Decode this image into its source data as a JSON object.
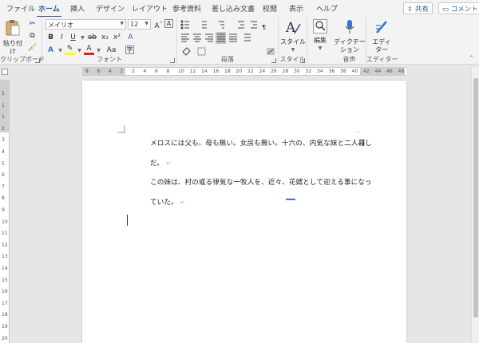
{
  "tabs": [
    "ファイル",
    "ホーム",
    "挿入",
    "デザイン",
    "レイアウト",
    "参考資料",
    "差し込み文書",
    "校閲",
    "表示",
    "ヘルプ"
  ],
  "active_tab": "ホーム",
  "share_label": "共有",
  "comment_label": "コメント",
  "clipboard": {
    "paste_label": "貼り付け",
    "group_label": "クリップボード"
  },
  "font": {
    "name": "メイリオ",
    "size": "12",
    "group_label": "フォント",
    "bold": "B",
    "italic": "I",
    "underline": "U",
    "strike": "ab",
    "sub": "x₂",
    "sup": "x²",
    "color_a": "A",
    "clear": "A"
  },
  "paragraph": {
    "group_label": "段落"
  },
  "styles": {
    "label": "スタイル",
    "group_label": "スタイル"
  },
  "editing": {
    "label": "編集"
  },
  "voice": {
    "label1": "ディクテー",
    "label2": "ション",
    "group_label": "音声"
  },
  "editor": {
    "label1": "エディ",
    "label2": "ター",
    "group_label": "エディター"
  },
  "ruler_h": [
    "8",
    "6",
    "4",
    "2",
    "2",
    "4",
    "6",
    "8",
    "10",
    "12",
    "14",
    "16",
    "18",
    "20",
    "22",
    "24",
    "26",
    "28",
    "30",
    "32",
    "34",
    "36",
    "38",
    "40",
    "42",
    "44",
    "46",
    "48"
  ],
  "ruler_v": [
    "2",
    "1",
    "1",
    "2",
    "3",
    "4",
    "5",
    "6",
    "7",
    "8",
    "9",
    "10",
    "11",
    "12",
    "13",
    "14",
    "15",
    "16",
    "17",
    "18",
    "19",
    "20"
  ],
  "document": {
    "lines": [
      "メロスには父も、母も無い。女房も無い。十六の、内気な妹と二人暮し",
      "だ。",
      "この妹は、村の或る律気な一牧人を、近々、花婿として迎える事になっ",
      "ていた。"
    ],
    "paragraph_mark": "↵"
  }
}
